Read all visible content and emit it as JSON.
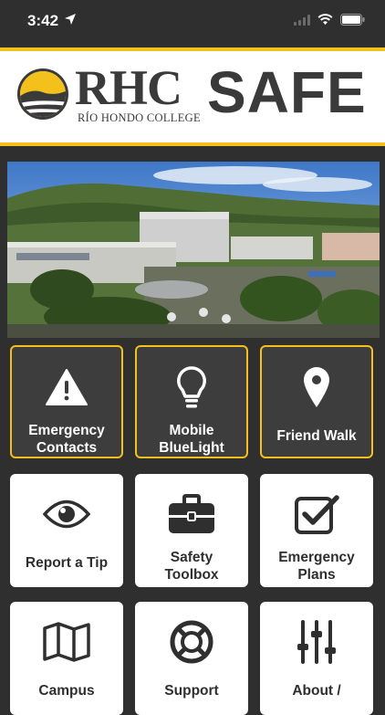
{
  "status": {
    "time": "3:42"
  },
  "header": {
    "rhc": "RHC",
    "college": "RÍO HONDO COLLEGE",
    "safe": "SAFE"
  },
  "tiles": [
    {
      "label": "Emergency\nContacts",
      "icon": "warning-icon"
    },
    {
      "label": "Mobile\nBlueLight",
      "icon": "lightbulb-icon"
    },
    {
      "label": "Friend Walk",
      "icon": "location-pin-icon"
    },
    {
      "label": "Report a Tip",
      "icon": "eye-icon"
    },
    {
      "label": "Safety\nToolbox",
      "icon": "toolbox-icon"
    },
    {
      "label": "Emergency\nPlans",
      "icon": "checkbox-icon"
    },
    {
      "label": "Campus",
      "icon": "map-icon"
    },
    {
      "label": "Support",
      "icon": "lifebuoy-icon"
    },
    {
      "label": "About /",
      "icon": "sliders-icon"
    }
  ],
  "colors": {
    "accent": "#f3c01c",
    "background": "#2f2f2f",
    "tile_dark": "#3d3d3d"
  }
}
